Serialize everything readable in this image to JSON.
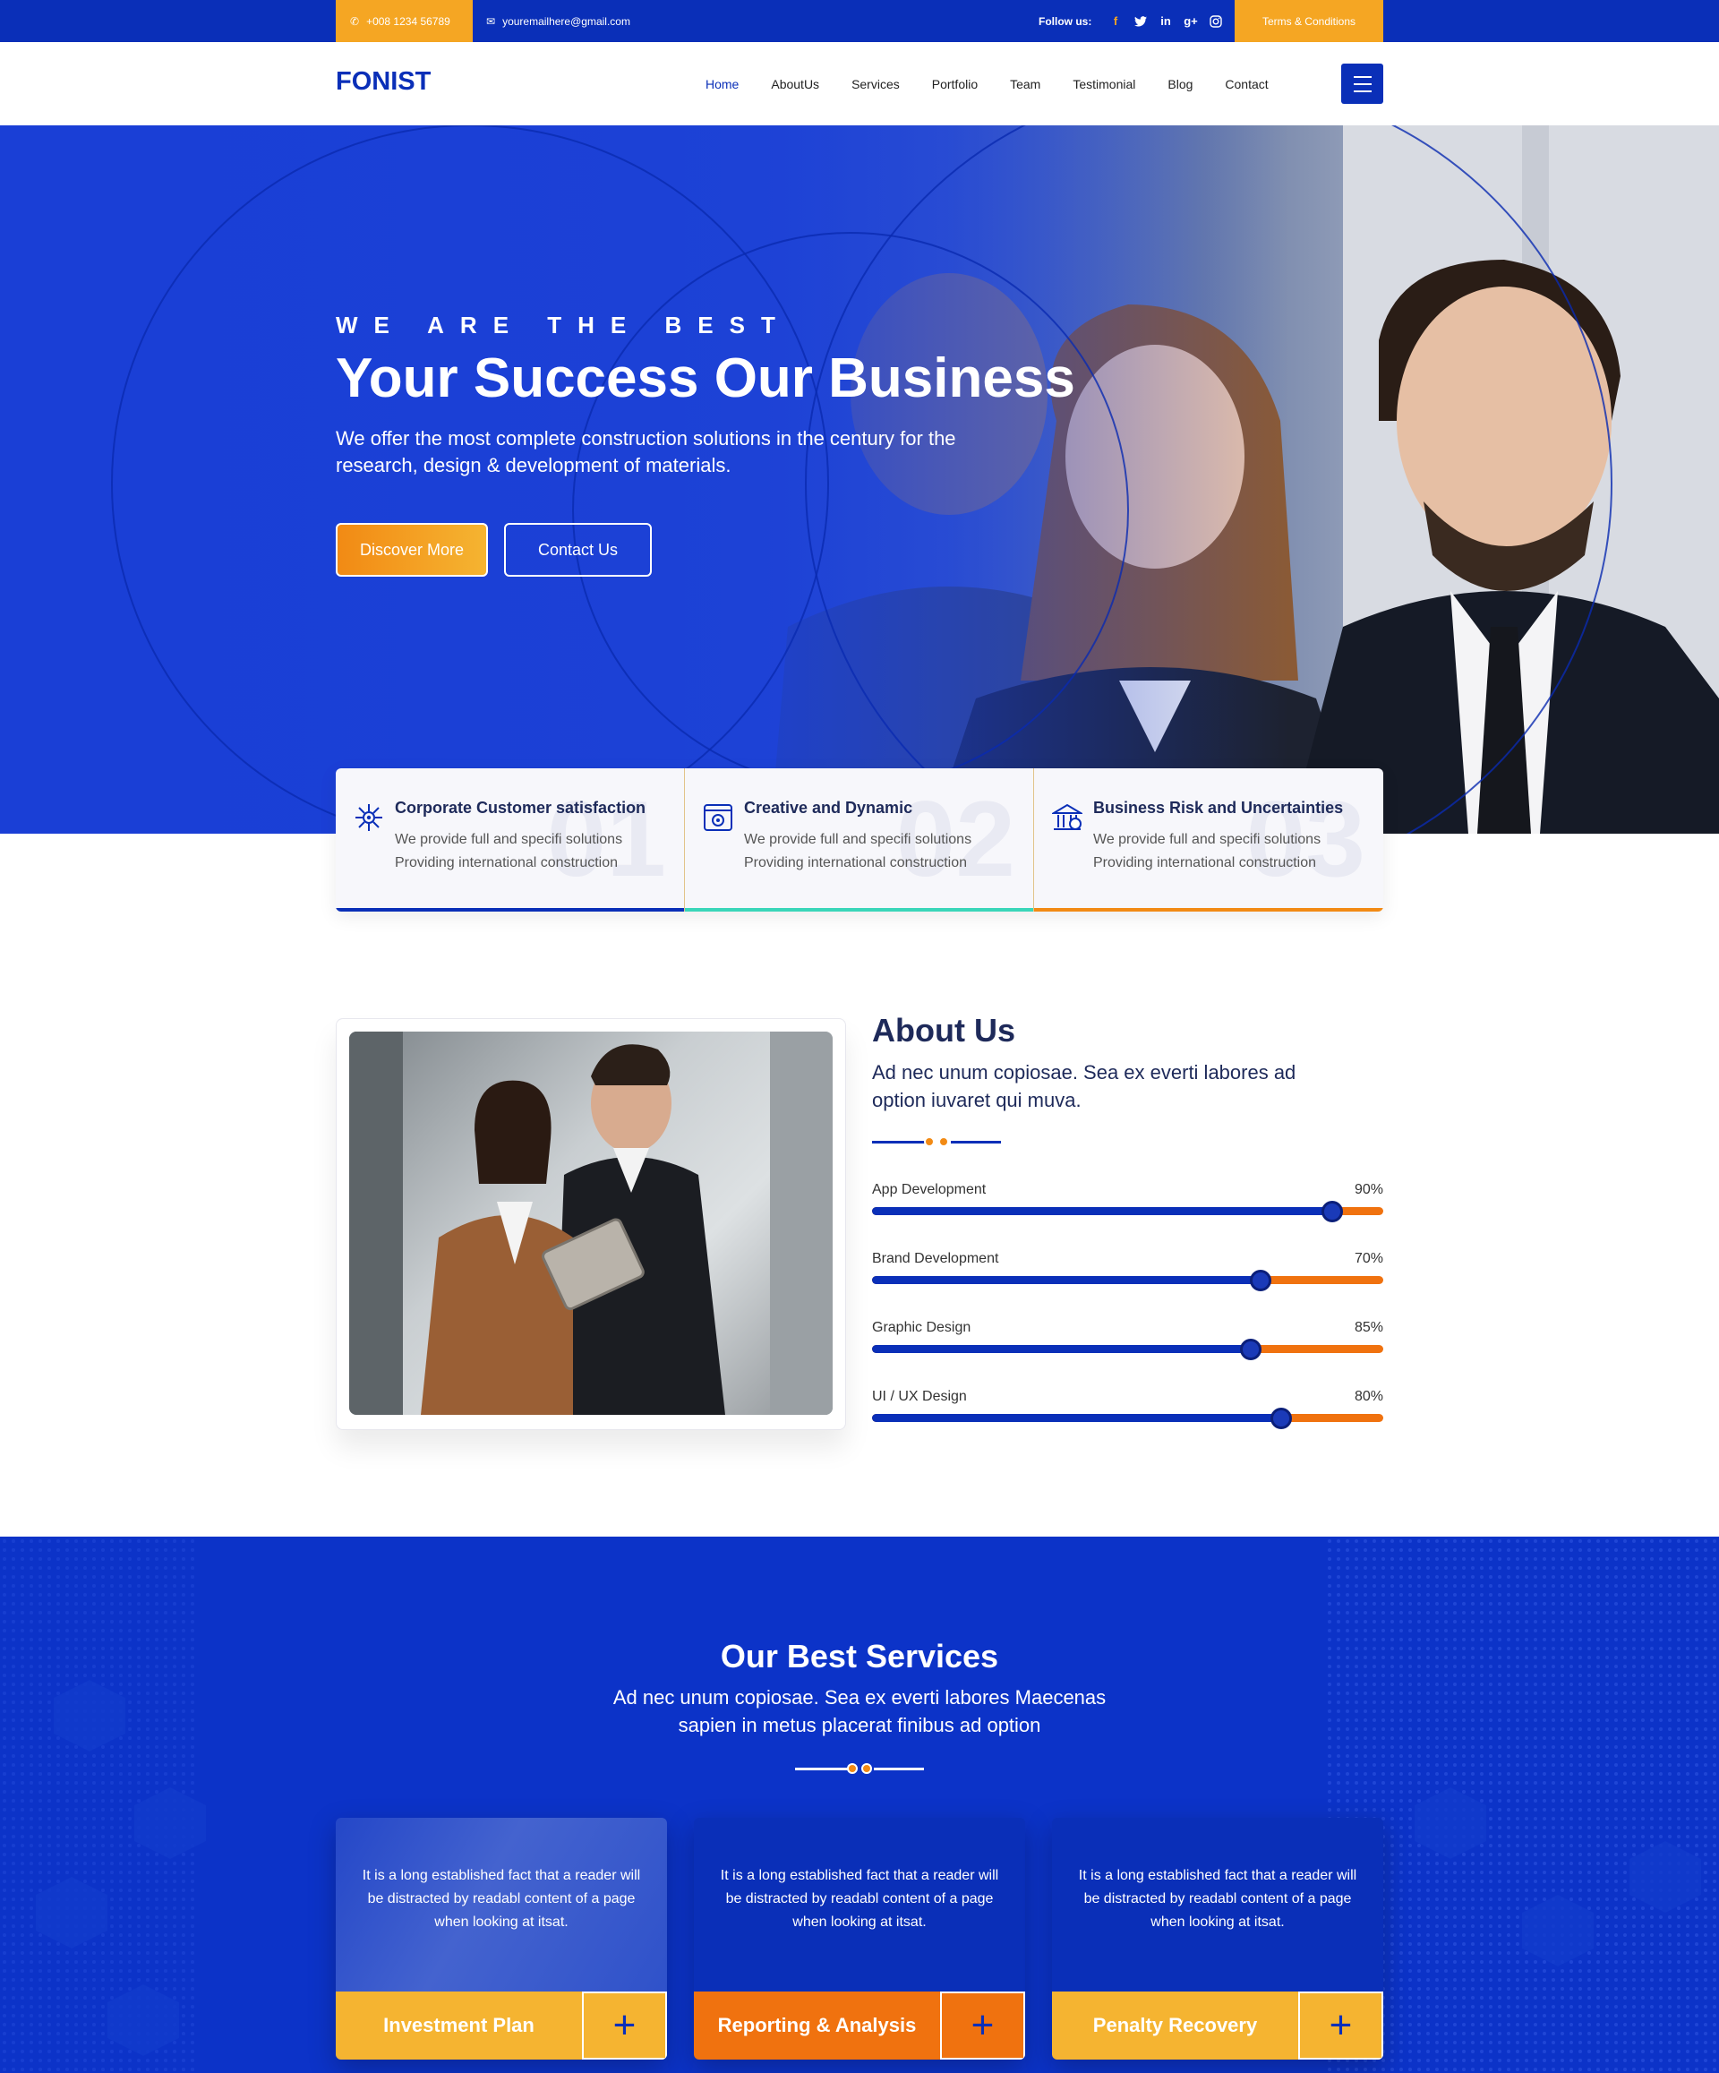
{
  "topbar": {
    "phone": "+008 1234 56789",
    "email": "youremailhere@gmail.com",
    "follow_label": "Follow us:",
    "social": [
      "f",
      "t",
      "in",
      "g+",
      "ig"
    ],
    "terms": "Terms & Conditions"
  },
  "nav": {
    "logo": "FONIST",
    "items": [
      "Home",
      "AboutUs",
      "Services",
      "Portfolio",
      "Team",
      "Testimonial",
      "Blog",
      "Contact"
    ]
  },
  "hero": {
    "kicker": "WE ARE THE BEST",
    "title": "Your Success Our Business",
    "subtitle": "We offer the most complete construction solutions in the century for the research, design & development of materials.",
    "btn_primary": "Discover More",
    "btn_secondary": "Contact Us"
  },
  "features": [
    {
      "num": "01",
      "title": "Corporate Customer satisfaction",
      "text": "We provide full and specifi solutions Providing international construction",
      "bar_color": "#0a2fb8"
    },
    {
      "num": "02",
      "title": "Creative and Dynamic",
      "text": "We provide full and specifi solutions Providing international construction",
      "bar_color": "#3ad6b9"
    },
    {
      "num": "03",
      "title": "Business Risk and Uncertainties",
      "text": "We provide full and specifi solutions Providing international construction",
      "bar_color": "#f28a14"
    }
  ],
  "about": {
    "title": "About Us",
    "subtitle": "Ad nec unum copiosae. Sea ex everti labores ad option iuvaret qui muva.",
    "skills": [
      {
        "label": "App Development",
        "percent_label": "90%",
        "value": 0.9
      },
      {
        "label": "Brand Development",
        "percent_label": "70%",
        "value": 0.76
      },
      {
        "label": "Graphic Design",
        "percent_label": "85%",
        "value": 0.74
      },
      {
        "label": "UI / UX Design",
        "percent_label": "80%",
        "value": 0.8
      }
    ]
  },
  "services": {
    "title": "Our Best Services",
    "subtitle": "Ad nec unum copiosae. Sea ex everti labores Maecenas sapien in metus placerat finibus ad option",
    "cards": [
      {
        "text": "It is a long established fact that a reader will be distracted by readabl content of a page when looking at itsat.",
        "name": "Investment Plan",
        "color": "#f5b431"
      },
      {
        "text": "It is a long established fact that a reader will be distracted by readabl content of a page when looking at itsat.",
        "name": "Reporting & Analysis",
        "color": "#f0720f"
      },
      {
        "text": "It is a long established fact that a reader will be distracted by readabl content of a page when looking at itsat.",
        "name": "Penalty Recovery",
        "color": "#f5b431"
      }
    ]
  },
  "colors": {
    "primary": "#0a2fb8",
    "accent": "#f5a623",
    "orange": "#f0720f",
    "teal": "#3ad6b9"
  }
}
